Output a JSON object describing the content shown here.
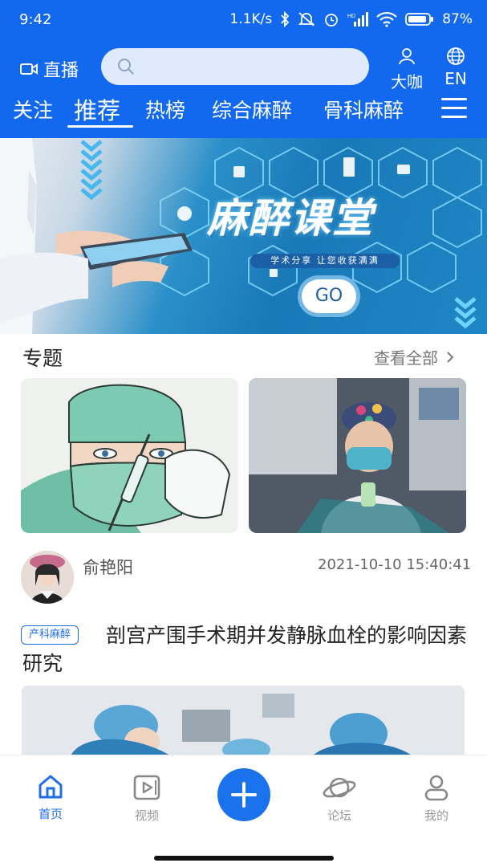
{
  "status_bar": {
    "time": "9:42",
    "network_speed": "1.1K/s",
    "battery": "87%",
    "hd_label": "HD"
  },
  "header": {
    "live_label": "直播",
    "search_placeholder": "",
    "experts_label": "大咖",
    "language_label": "EN"
  },
  "tabs": [
    {
      "label": "关注",
      "active": false
    },
    {
      "label": "推荐",
      "active": true
    },
    {
      "label": "热榜",
      "active": false
    },
    {
      "label": "综合麻醉",
      "active": false
    },
    {
      "label": "骨科麻醉",
      "active": false
    }
  ],
  "banner": {
    "title": "麻醉课堂",
    "subtitle": "学术分享 让您收获满满",
    "button_label": "GO"
  },
  "topics": {
    "title": "专题",
    "view_all": "查看全部"
  },
  "post": {
    "author": "俞艳阳",
    "time": "2021-10-10 15:40:41",
    "tag": "产科麻醉",
    "title": "剖宫产围手术期并发静脉血栓的影响因素研究"
  },
  "bottom_nav": [
    {
      "label": "首页",
      "icon": "home-icon",
      "active": true
    },
    {
      "label": "视频",
      "icon": "video-icon",
      "active": false
    },
    {
      "label": "",
      "icon": "plus-icon",
      "active": false
    },
    {
      "label": "论坛",
      "icon": "planet-icon",
      "active": false
    },
    {
      "label": "我的",
      "icon": "user-icon",
      "active": false
    }
  ],
  "colors": {
    "brand_blue": "#1269f0",
    "accent": "#1f6de8"
  }
}
